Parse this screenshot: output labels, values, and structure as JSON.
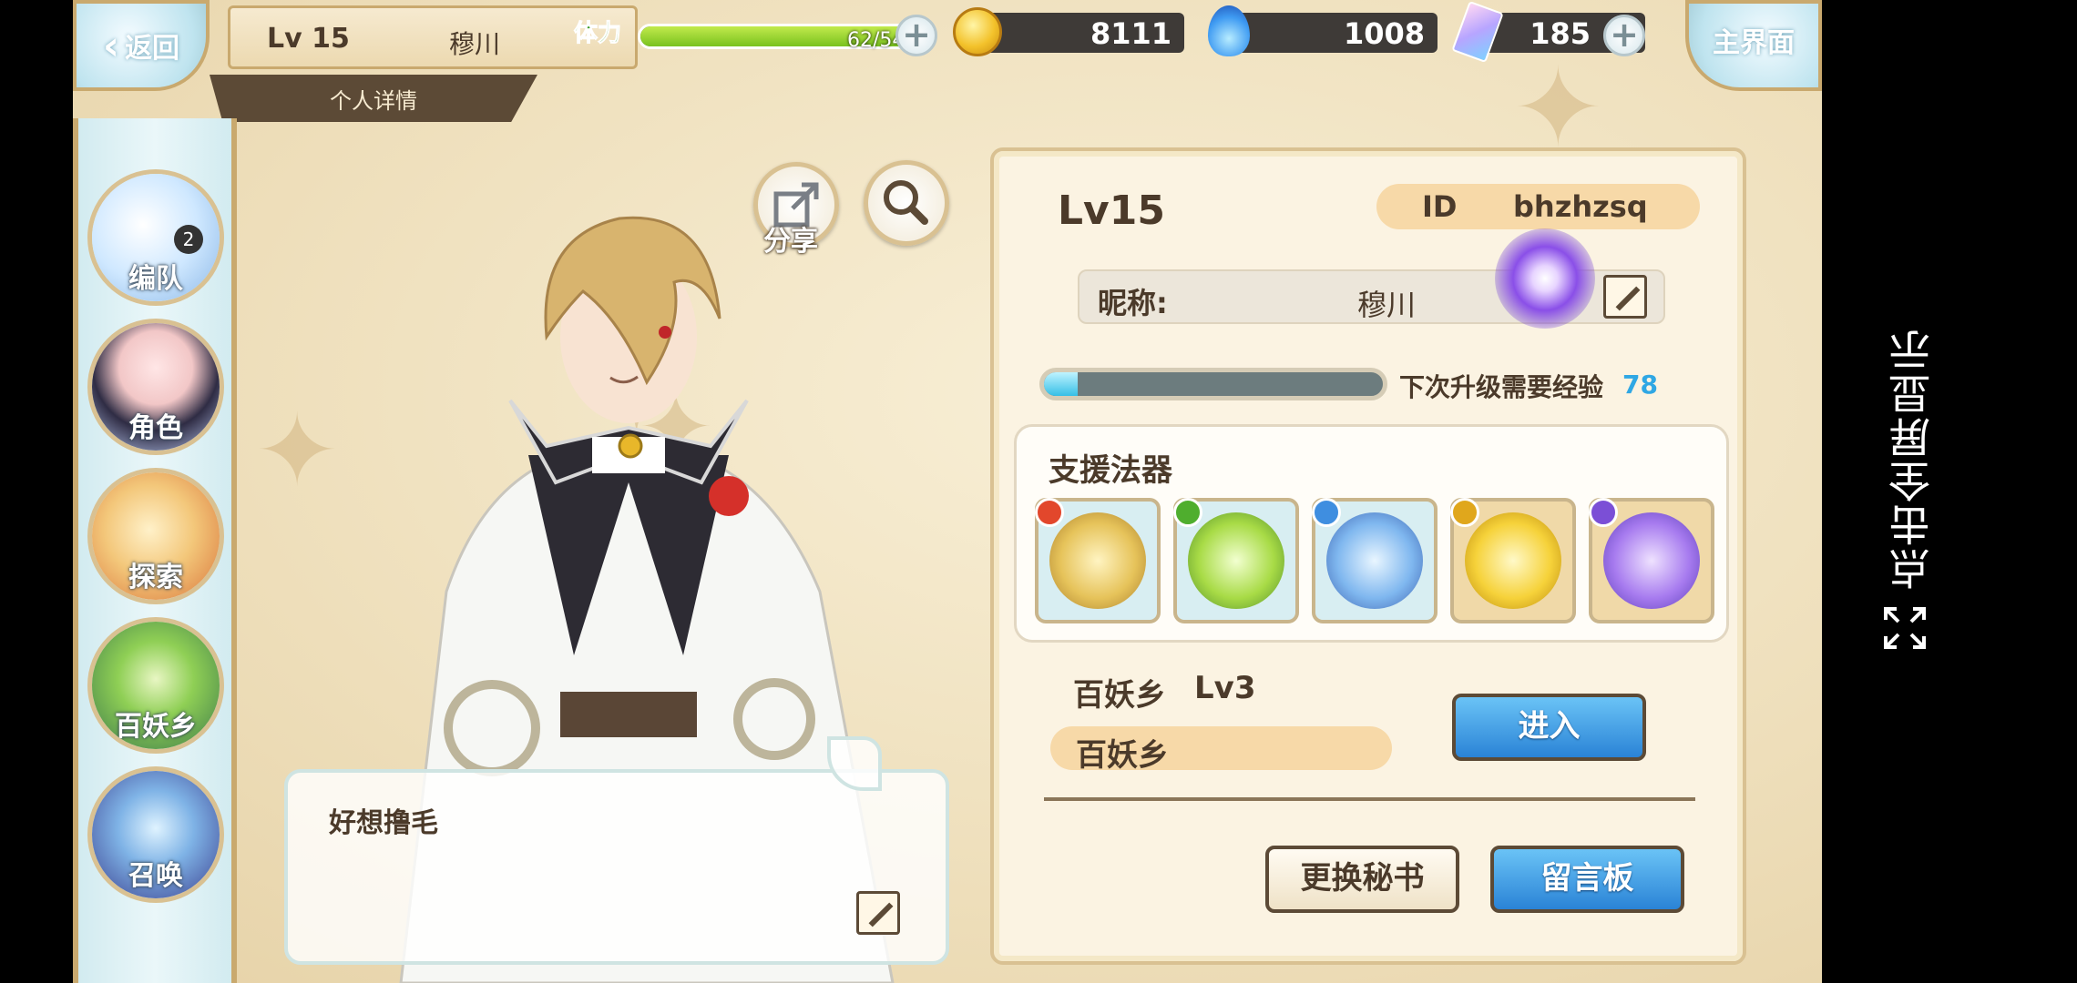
{
  "topbar": {
    "back_label": "返回",
    "level": "Lv 15",
    "name": "穆川",
    "detail_tab": "个人详情",
    "stamina_label": "体力",
    "stamina_value": "62/54",
    "stamina_fraction": 1.0,
    "gold": "8111",
    "soul": "1008",
    "crystal": "185",
    "home_label": "主界面"
  },
  "sidebar": {
    "items": [
      {
        "label": "编队",
        "badge": "2"
      },
      {
        "label": "角色"
      },
      {
        "label": "探索"
      },
      {
        "label": "百妖乡"
      },
      {
        "label": "召唤"
      }
    ]
  },
  "actions": {
    "share_label": "分享"
  },
  "speech": {
    "text": "好想撸毛"
  },
  "panel": {
    "level": "Lv15",
    "id_label": "ID",
    "id_value": "bhzhzsq",
    "nickname_label": "昵称:",
    "nickname_value": "穆川",
    "exp_label": "下次升级需要经验",
    "exp_value": "78",
    "exp_fraction": 0.1,
    "support_title": "支援法器",
    "artifacts": [
      {
        "name": "golden-rings-artifact",
        "element_color": "#e2472c"
      },
      {
        "name": "green-blade-artifact",
        "element_color": "#4fae2e"
      },
      {
        "name": "blue-earrings-artifact",
        "element_color": "#3f8ee0"
      },
      {
        "name": "golden-orb-artifact",
        "element_color": "#e0a71c"
      },
      {
        "name": "purple-stars-artifact",
        "element_color": "#7b4fd6"
      }
    ],
    "realm_name": "百妖乡",
    "realm_level": "Lv3",
    "realm_pill": "百妖乡",
    "enter_label": "进入",
    "change_secretary_label": "更换秘书",
    "message_board_label": "留言板"
  },
  "overlay": {
    "fullscreen_hint": "点击全屏显示"
  },
  "colors": {
    "accent_blue": "#2a83d6",
    "panel_bg": "#fbf3e2",
    "text_brown": "#4b3a2a",
    "exp_blue": "#2fa7e4"
  }
}
